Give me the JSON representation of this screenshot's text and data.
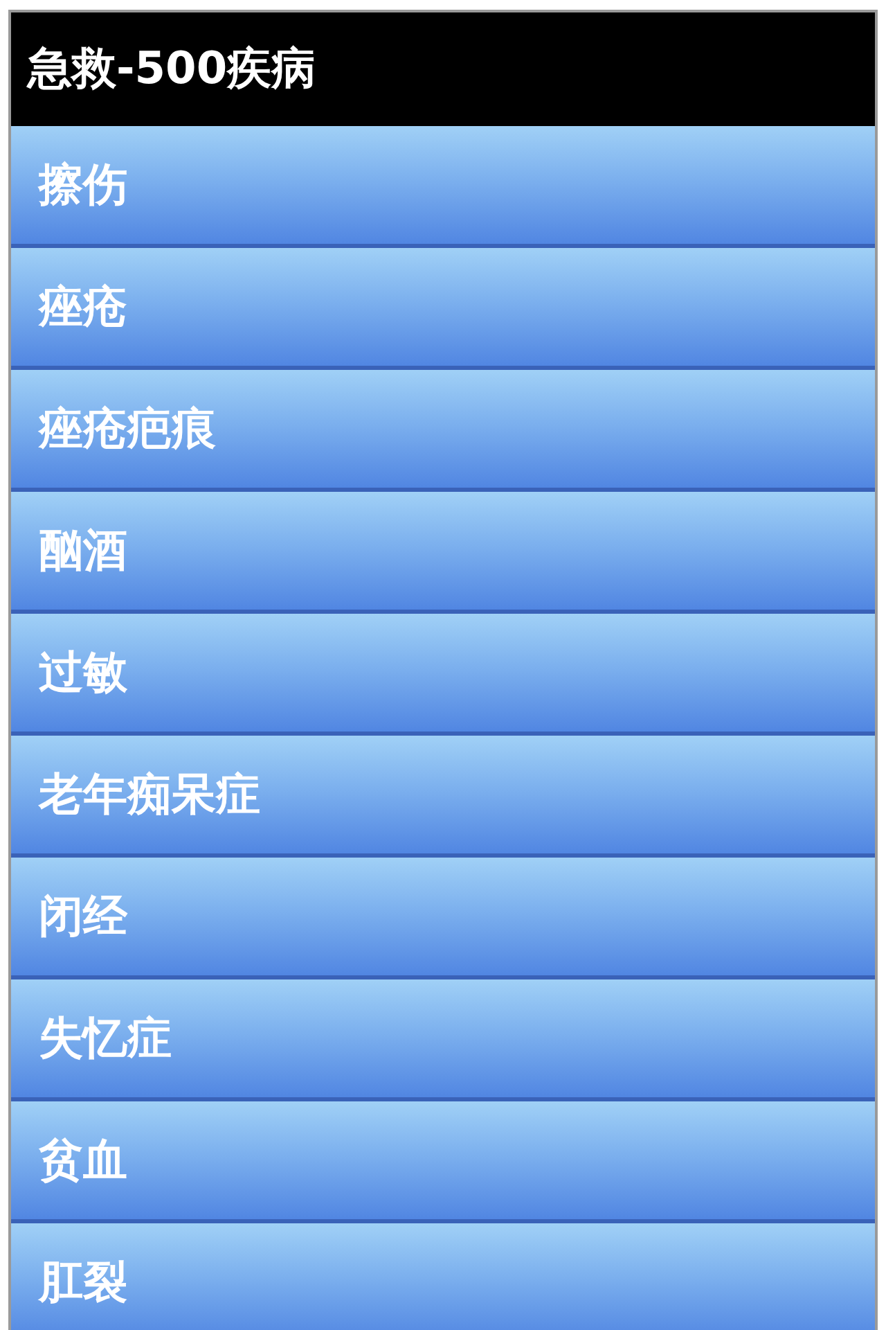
{
  "header": {
    "title": "急救-500疾病"
  },
  "list": {
    "items": [
      {
        "label": "擦伤"
      },
      {
        "label": "痤疮"
      },
      {
        "label": "痤疮疤痕"
      },
      {
        "label": "酗酒"
      },
      {
        "label": "过敏"
      },
      {
        "label": "老年痴呆症"
      },
      {
        "label": "闭经"
      },
      {
        "label": "失忆症"
      },
      {
        "label": "贫血"
      },
      {
        "label": "肛裂"
      }
    ]
  }
}
